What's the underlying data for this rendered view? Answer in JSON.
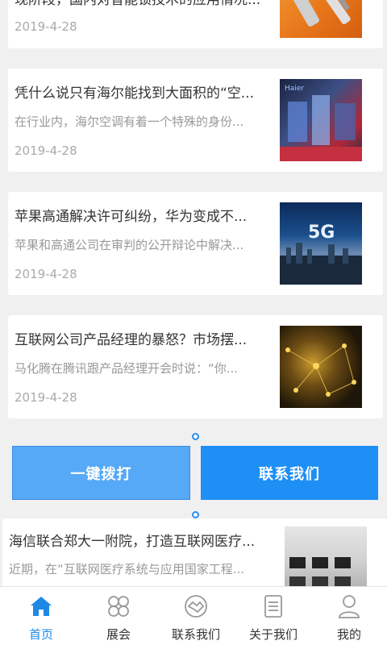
{
  "news": [
    {
      "title": "现阶段，国内对智能锁技术的应用情况...",
      "summary": "",
      "date": "2019-4-28"
    },
    {
      "title": "凭什么说只有海尔能找到大面积的“空...",
      "summary": "在行业内，海尔空调有着一个特殊的身份...",
      "date": "2019-4-28"
    },
    {
      "title": "苹果高通解决许可纠纷，华为变成不...",
      "summary": "苹果和高通公司在审判的公开辩论中解决...",
      "date": "2019-4-28"
    },
    {
      "title": "互联网公司产品经理的暴怒？市场摆...",
      "summary": "马化腾在腾讯跟产品经理开会时说：“你...",
      "date": "2019-4-28"
    },
    {
      "title": "海信联合郑大一附院，打造互联网医疗...",
      "summary": "近期，在“互联网医疗系统与应用国家工程...",
      "date": ""
    }
  ],
  "thumbs": {
    "haier_text": "Haier",
    "fiveg_text": "5G"
  },
  "actions": {
    "call_label": "一键拨打",
    "contact_label": "联系我们"
  },
  "tabbar": [
    {
      "label": "首页",
      "icon": "home-icon",
      "active": true
    },
    {
      "label": "展会",
      "icon": "expo-icon",
      "active": false
    },
    {
      "label": "联系我们",
      "icon": "handshake-icon",
      "active": false
    },
    {
      "label": "关于我们",
      "icon": "document-icon",
      "active": false
    },
    {
      "label": "我的",
      "icon": "user-icon",
      "active": false
    }
  ],
  "colors": {
    "accent": "#1e88e5",
    "call_button": "#55a9f7",
    "contact_button": "#1e8ff5"
  }
}
